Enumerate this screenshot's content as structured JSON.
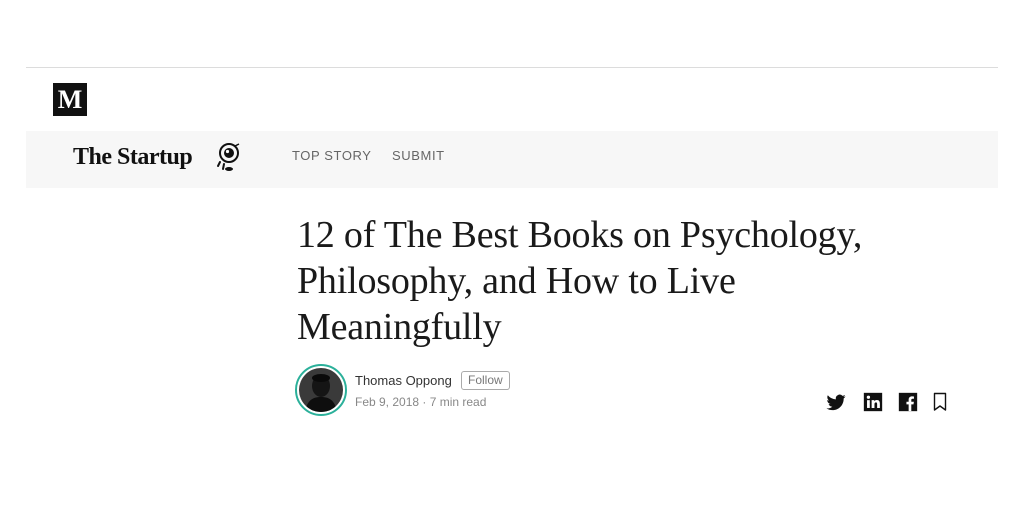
{
  "site": {
    "logo_letter": "M"
  },
  "publication": {
    "name": "The Startup",
    "nav": [
      {
        "label": "TOP STORY"
      },
      {
        "label": "SUBMIT"
      }
    ]
  },
  "article": {
    "title": "12 of The Best Books on Psychology, Philosophy, and How to Live Meaningfully",
    "author": "Thomas Oppong",
    "follow_label": "Follow",
    "date": "Feb 9, 2018",
    "read_time": "7 min read",
    "meta_text": "Feb 9, 2018 · 7 min read"
  },
  "share": {
    "icons": [
      "twitter-icon",
      "linkedin-icon",
      "facebook-icon",
      "bookmark-icon"
    ]
  },
  "colors": {
    "accent_ring": "#2bb09a",
    "pub_bar_bg": "#f7f7f7"
  }
}
